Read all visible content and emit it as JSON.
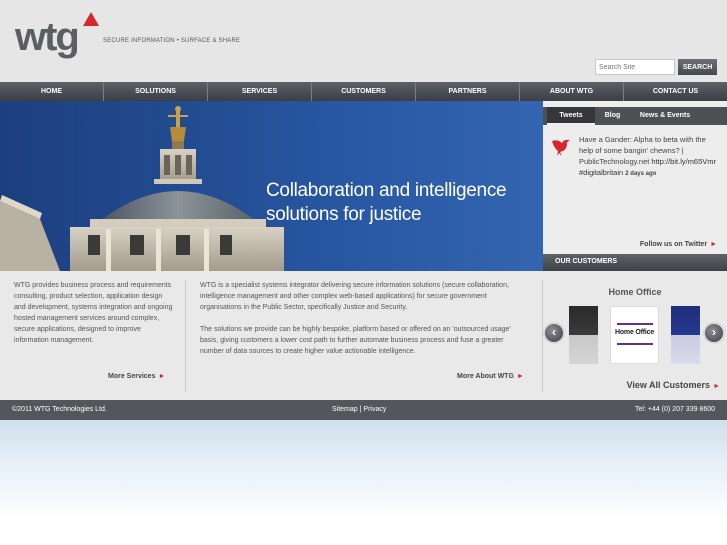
{
  "header": {
    "logo_text": "wtg",
    "tagline": "SECURE INFORMATION • SURFACE & SHARE",
    "search_placeholder": "Search Site",
    "search_button": "SEARCH"
  },
  "nav": {
    "items": [
      "HOME",
      "SOLUTIONS",
      "SERVICES",
      "CUSTOMERS",
      "PARTNERS",
      "ABOUT WTG",
      "CONTACT US"
    ]
  },
  "hero": {
    "title": "Collaboration and intelligence solutions for justice"
  },
  "social": {
    "tabs": [
      "Tweets",
      "Blog",
      "News & Events"
    ],
    "tweet_text": "Have a Gander: Alpha to beta with the help of some bangin' chewns? | PublicTechnology.net",
    "tweet_link": "http://bit.ly/m65Vmr #digitalbritain",
    "tweet_age": "2 days ago",
    "follow_label": "Follow us on Twitter"
  },
  "customers": {
    "bar_title": "OUR CUSTOMERS",
    "current_name": "Home Office",
    "logo_text": "Home Office",
    "view_all": "View All Customers",
    "prev_glyph": "‹",
    "next_glyph": "›"
  },
  "content": {
    "col1": "WTG provides business process and requirements consulting, product selection, application design and development, systems integration and ongoing hosted management services around complex, secure applications, designed to improve information management.",
    "more_services": "More Services",
    "col2_p1": "WTG is a specialist systems integrator delivering secure information solutions (secure collaboration, intelligence management and other complex web-based applications) for secure government organisations in the Public Sector, specifically Justice and Security.",
    "col2_p2": "The solutions we provide can be highly bespoke, platform based or offered on an 'outsourced usage' basis, giving customers a lower cost path to further automate business process and fuse a greater number of data sources to create higher value actionable intelligence.",
    "more_about": "More About WTG"
  },
  "footer": {
    "copyright": "©2011 WTG Technologies Ltd.",
    "sitemap": "Sitemap",
    "separator": "|",
    "privacy": "Privacy",
    "phone": "Tel: +44 (0) 207 339 8600"
  },
  "colors": {
    "accent_red": "#d8262e",
    "nav_dark": "#45484d",
    "hero_blue": "#234e94"
  }
}
